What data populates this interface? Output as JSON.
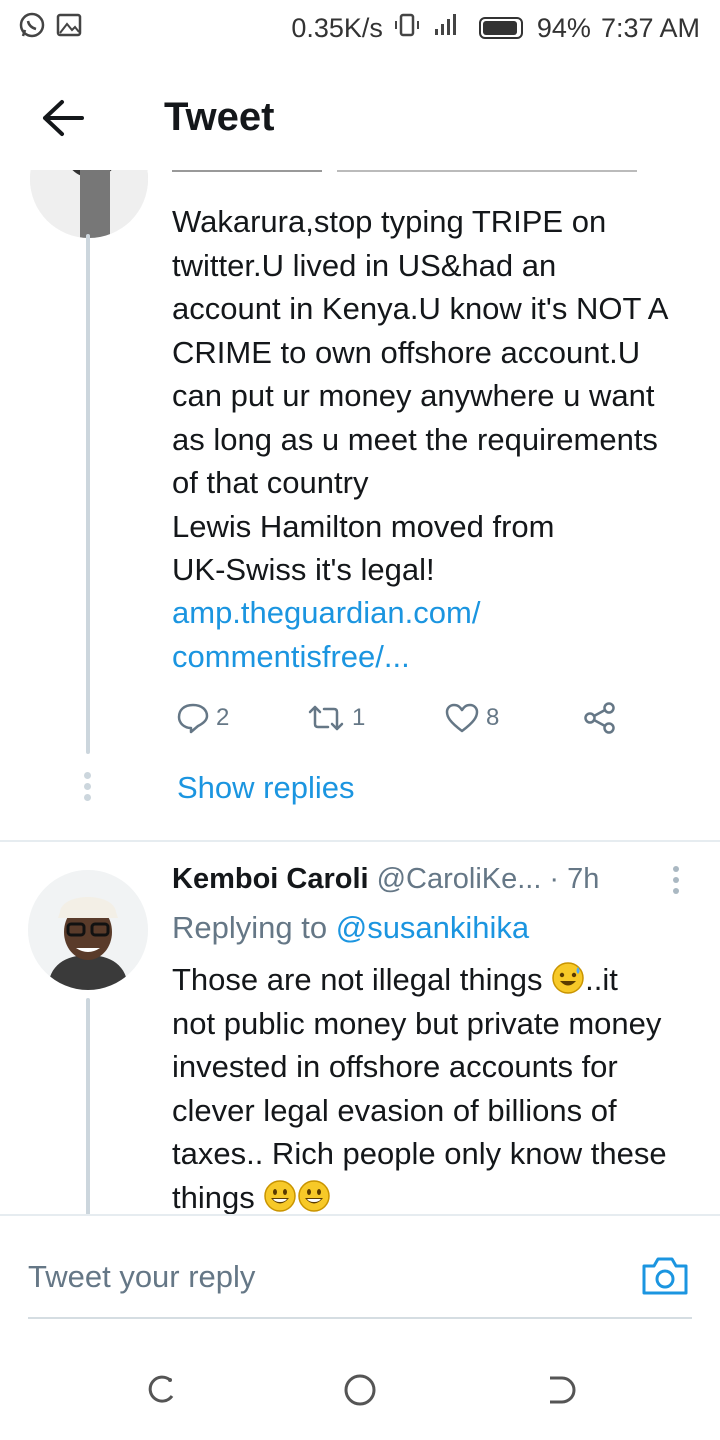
{
  "status_bar": {
    "net_speed": "0.35K/s",
    "battery": "94%",
    "time": "7:37 AM"
  },
  "header": {
    "title": "Tweet"
  },
  "tweet1": {
    "body": "Wakarura,stop typing TRIPE on\ntwitter.U lived in US&had an\naccount in Kenya.U know it's NOT A\nCRIME to own offshore account.U\ncan put ur money anywhere u want\nas long as u meet the requirements\nof that country\nLewis Hamilton moved from\nUK-Swiss it's legal!",
    "link_line1": "amp.theguardian.com/",
    "link_line2": "commentisfree/...",
    "reply_count": "2",
    "retweet_count": "1",
    "like_count": "8",
    "show_replies": "Show replies"
  },
  "tweet2": {
    "name": "Kemboi Caroli",
    "handle": "@CaroliKe...",
    "time": "· 7h",
    "replying_prefix": "Replying to",
    "replying_handle": "@susankihika",
    "line1": "Those are not illegal things",
    "line1_suffix": "..it",
    "line2": "not public money but private money",
    "line3": "invested in offshore accounts for",
    "line4": "clever legal evasion of billions of",
    "line5": "taxes.. Rich people only know these",
    "line6": "things"
  },
  "composer": {
    "placeholder": "Tweet your reply"
  },
  "icons": {
    "accent": "#1b95e0",
    "secondary_text": "#657786"
  }
}
